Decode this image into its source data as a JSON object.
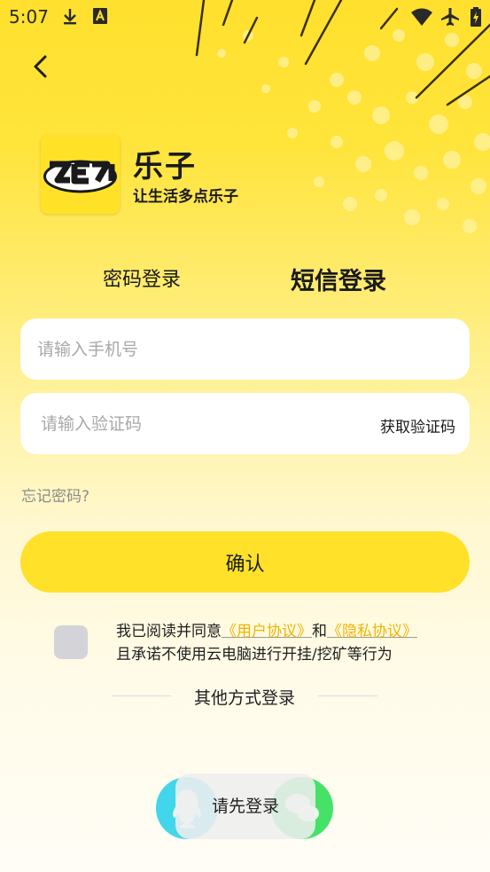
{
  "status_bar": {
    "time": "5:07",
    "icons": [
      "download-icon",
      "accessibility-icon",
      "wifi-icon",
      "airplane-mode-icon",
      "battery-charging-icon"
    ]
  },
  "nav": {
    "back_icon": "chevron-left-icon"
  },
  "brand": {
    "logo_text": "乐子",
    "app_name": "乐子",
    "slogan": "让生活多点乐子"
  },
  "tabs": {
    "password_login": "密码登录",
    "sms_login": "短信登录",
    "active": "sms_login"
  },
  "form": {
    "phone_placeholder": "请输入手机号",
    "phone_value": "",
    "code_placeholder": "请输入验证码",
    "code_value": "",
    "get_code_label": "获取验证码",
    "forgot_password": "忘记密码?",
    "confirm_label": "确认"
  },
  "agreement": {
    "checked": false,
    "prefix": "我已阅读并同意",
    "user_agreement": "《用户协议》",
    "and": "和",
    "privacy_policy": "《隐私协议》",
    "line2": "且承诺不使用云电脑进行开挂/挖矿等行为"
  },
  "other_login": {
    "label": "其他方式登录",
    "providers": [
      "qq-icon",
      "wechat-icon"
    ]
  },
  "toast": {
    "message": "请先登录"
  },
  "colors": {
    "brand_yellow": "#ffe12a",
    "link": "#f0b400",
    "qq": "#41d6ea",
    "wechat": "#46e268"
  }
}
